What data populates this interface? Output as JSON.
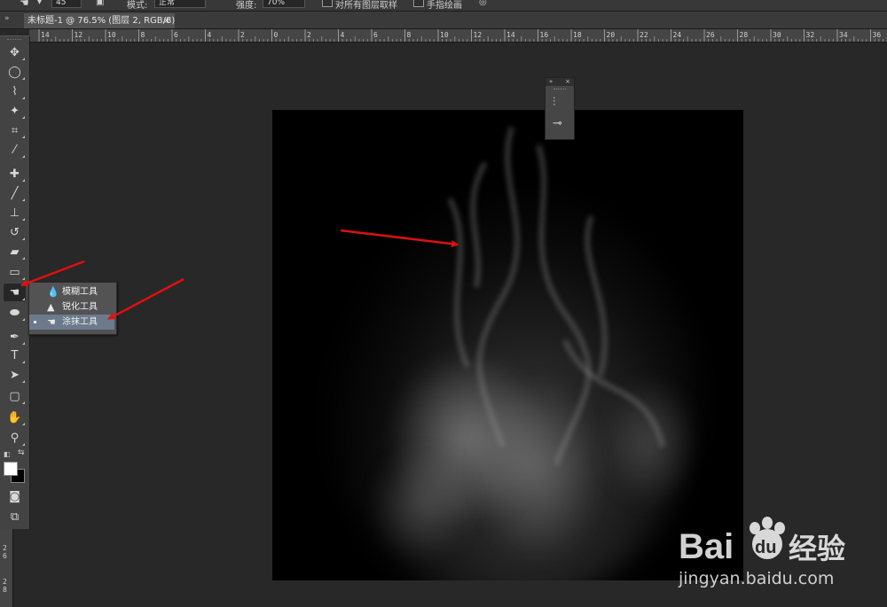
{
  "options_bar": {
    "brush_size": "45",
    "mode_label": "模式:",
    "mode_value": "正常",
    "strength_label": "强度:",
    "strength_value": "70%",
    "sample_all_layers_label": "对所有图层取样",
    "finger_painting_label": "手指绘画"
  },
  "document_tab": {
    "title": "未标题-1 @ 76.5% (图层 2, RGB/8) *",
    "close_glyph": "×"
  },
  "ruler_h_labels": [
    "14",
    "12",
    "10",
    "8",
    "6",
    "4",
    "2",
    "0",
    "2",
    "4",
    "6",
    "8",
    "10",
    "12",
    "14",
    "16",
    "18",
    "20",
    "22",
    "24",
    "26",
    "28",
    "30",
    "32",
    "34",
    "36"
  ],
  "ruler_v_labels": [
    "2",
    "6",
    "2",
    "8"
  ],
  "toolbox": {
    "tools": [
      {
        "name": "move-tool",
        "icon": "move-icon",
        "glyph": "✥"
      },
      {
        "name": "marquee-tool",
        "icon": "ellipse-marquee-icon",
        "glyph": "◯"
      },
      {
        "name": "lasso-tool",
        "icon": "polygon-lasso-icon",
        "glyph": "⌇"
      },
      {
        "name": "magic-wand-tool",
        "icon": "magic-wand-icon",
        "glyph": "✦"
      },
      {
        "name": "crop-tool",
        "icon": "crop-icon",
        "glyph": "⌗"
      },
      {
        "name": "eyedropper-tool",
        "icon": "eyedropper-icon",
        "glyph": "⁄"
      },
      {
        "name": "healing-brush-tool",
        "icon": "bandage-icon",
        "glyph": "✚"
      },
      {
        "name": "brush-tool",
        "icon": "brush-icon",
        "glyph": "╱"
      },
      {
        "name": "clone-stamp-tool",
        "icon": "stamp-icon",
        "glyph": "⊥"
      },
      {
        "name": "history-brush-tool",
        "icon": "history-brush-icon",
        "glyph": "↺"
      },
      {
        "name": "eraser-tool",
        "icon": "eraser-icon",
        "glyph": "▰"
      },
      {
        "name": "gradient-tool",
        "icon": "gradient-icon",
        "glyph": "▭"
      },
      {
        "name": "smudge-tool",
        "icon": "smudge-finger-icon",
        "glyph": "☚"
      },
      {
        "name": "dodge-tool",
        "icon": "dodge-icon",
        "glyph": "⬬"
      },
      {
        "name": "pen-tool",
        "icon": "pen-icon",
        "glyph": "✒"
      },
      {
        "name": "type-tool",
        "icon": "type-icon",
        "glyph": "T"
      },
      {
        "name": "path-selection-tool",
        "icon": "path-select-icon",
        "glyph": "➤"
      },
      {
        "name": "shape-tool",
        "icon": "rounded-rect-icon",
        "glyph": "▢"
      },
      {
        "name": "hand-tool",
        "icon": "hand-icon",
        "glyph": "✋"
      },
      {
        "name": "zoom-tool",
        "icon": "zoom-icon",
        "glyph": "⚲"
      }
    ]
  },
  "flyout": {
    "items": [
      {
        "label": "模糊工具",
        "icon": "blur-drop-icon",
        "glyph": "💧",
        "selected": false
      },
      {
        "label": "锐化工具",
        "icon": "sharpen-triangle-icon",
        "glyph": "▲",
        "selected": false
      },
      {
        "label": "涂抹工具",
        "icon": "smudge-finger-icon",
        "glyph": "☚",
        "selected": true
      }
    ]
  },
  "mini_panel": {
    "collapse_glyph": "»",
    "close_glyph": "×"
  },
  "watermark": {
    "brand_latin_1": "Bai",
    "brand_latin_2": "du",
    "brand_cn": "经验",
    "url": "jingyan.baidu.com"
  },
  "colors": {
    "app_bg": "#282828",
    "toolbox": "#434343",
    "flyout": "#535353",
    "flyout_selected": "#6b7a8c",
    "annotation_red": "#e01010"
  }
}
